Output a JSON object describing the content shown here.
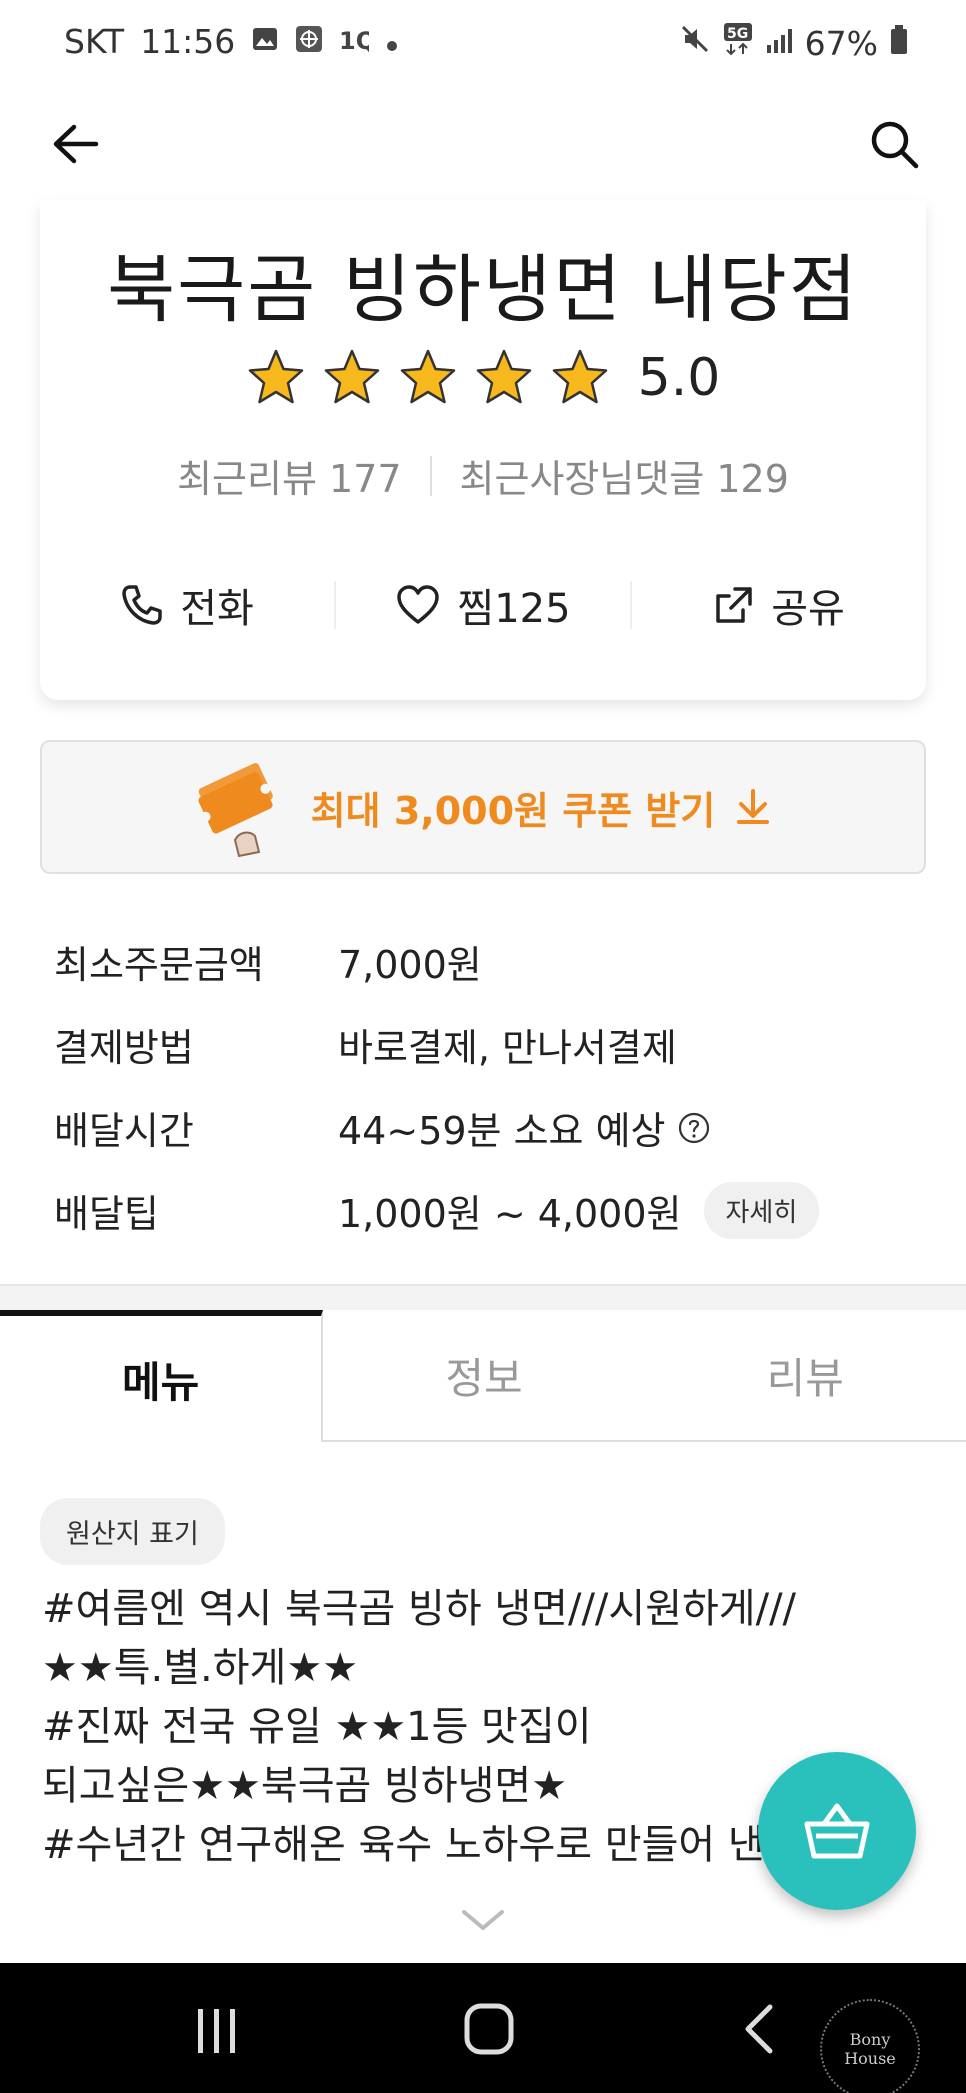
{
  "status_bar": {
    "carrier": "SKT",
    "time": "11:56",
    "battery": "67%",
    "network": "5G"
  },
  "app_bar": {
    "back_icon": "arrow-left-icon",
    "search_icon": "search-icon"
  },
  "store": {
    "name": "북극곰 빙하냉면 내당점",
    "rating": "5.0",
    "stars": 5,
    "recent_reviews": "최근리뷰 177",
    "owner_replies": "최근사장님댓글 129"
  },
  "actions": {
    "call": "전화",
    "like": "찜",
    "like_count": "125",
    "share": "공유"
  },
  "coupon": {
    "text": "최대 3,000원 쿠폰 받기",
    "accent_color": "#ef8a1f"
  },
  "info": [
    {
      "label": "최소주문금액",
      "value": "7,000원"
    },
    {
      "label": "결제방법",
      "value": "바로결제, 만나서결제"
    },
    {
      "label": "배달시간",
      "value": "44~59분 소요 예상"
    },
    {
      "label": "배달팁",
      "value": "1,000원 ~ 4,000원",
      "button": "자세히"
    }
  ],
  "tabs": [
    {
      "label": "메뉴",
      "active": true
    },
    {
      "label": "정보",
      "active": false
    },
    {
      "label": "리뷰",
      "active": false
    }
  ],
  "origin_chip": "원산지 표기",
  "description": [
    "#여름엔 역시 북극곰 빙하 냉면///시원하게///",
    "★★특.별.하게★★",
    "#진짜 전국 유일 ★★1등 맛집이",
    "되고싶은★★북극곰 빙하냉면★",
    "#수년간 연구해온 육수 노하우로 만들어 낸"
  ],
  "cart": {
    "icon": "basket-icon",
    "color": "#2ac1bc"
  },
  "watermark": "Bony House"
}
